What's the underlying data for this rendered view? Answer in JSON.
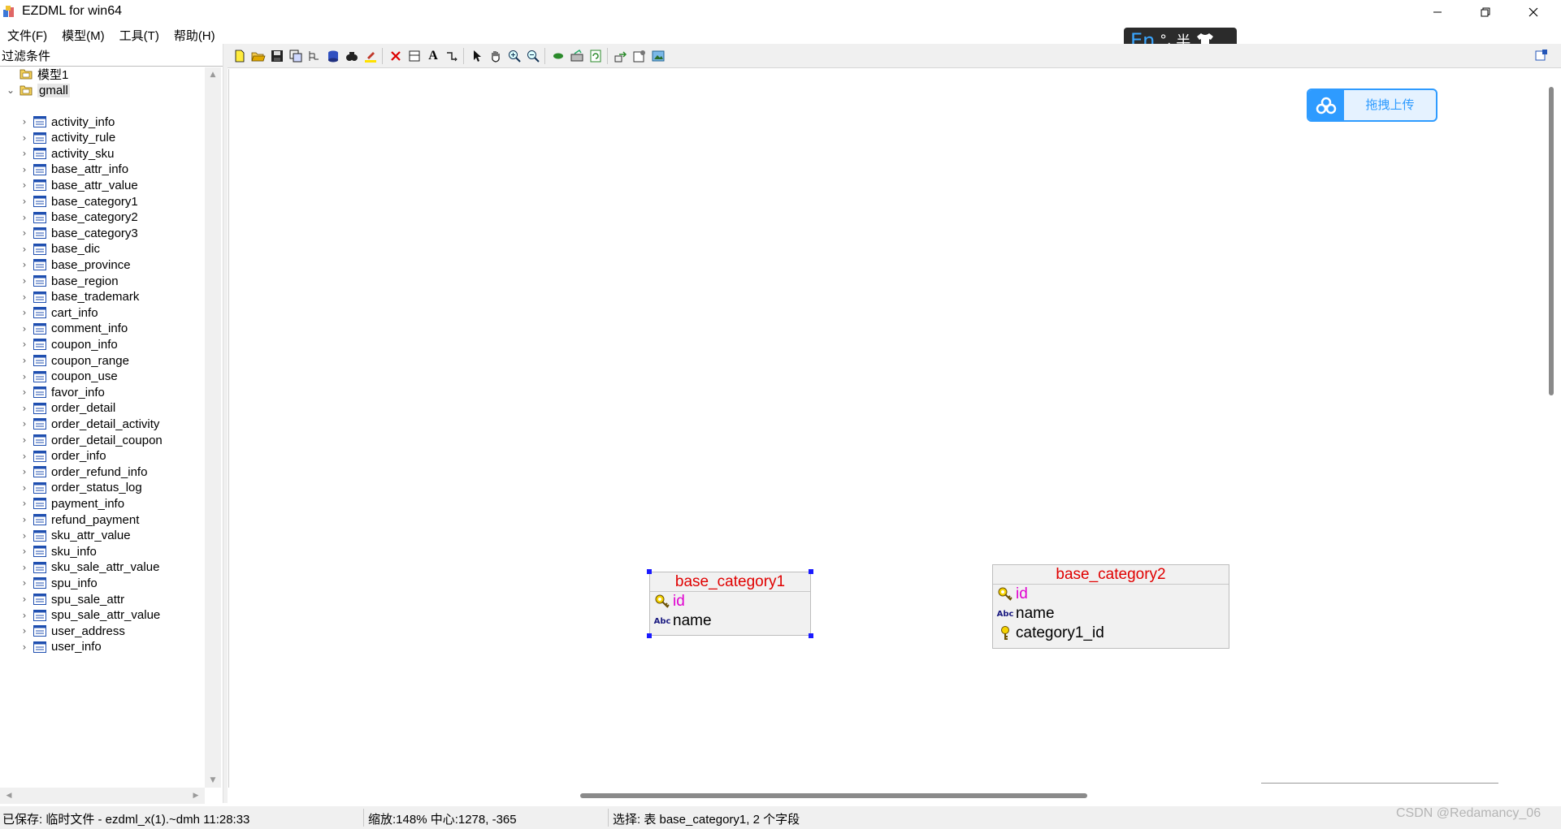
{
  "window": {
    "title": "EZDML for win64",
    "controls": {
      "minimize": "minimize-icon",
      "restore": "restore-icon",
      "close": "close-icon"
    }
  },
  "menu": [
    "文件(F)",
    "模型(M)",
    "工具(T)",
    "帮助(H)"
  ],
  "ime": {
    "lang": "En",
    "punct": "°,",
    "width": "半",
    "skin_icon": "shirt-icon"
  },
  "filter_label": "过滤条件",
  "tree": {
    "models": [
      {
        "label": "模型1",
        "icon": "model-folder-icon",
        "expanded": false
      },
      {
        "label": "gmall",
        "icon": "model-folder-icon",
        "expanded": true,
        "selected": true
      }
    ],
    "tables": [
      "activity_info",
      "activity_rule",
      "activity_sku",
      "base_attr_info",
      "base_attr_value",
      "base_category1",
      "base_category2",
      "base_category3",
      "base_dic",
      "base_province",
      "base_region",
      "base_trademark",
      "cart_info",
      "comment_info",
      "coupon_info",
      "coupon_range",
      "coupon_use",
      "favor_info",
      "order_detail",
      "order_detail_activity",
      "order_detail_coupon",
      "order_info",
      "order_refund_info",
      "order_status_log",
      "payment_info",
      "refund_payment",
      "sku_attr_value",
      "sku_info",
      "sku_sale_attr_value",
      "spu_info",
      "spu_sale_attr",
      "spu_sale_attr_value",
      "user_address",
      "user_info"
    ]
  },
  "toolbar": [
    "new-file-icon",
    "open-folder-icon",
    "save-icon",
    "save-as-icon",
    "tree-view-icon",
    "database-icon",
    "find-icon",
    "highlight-icon",
    "delete-icon",
    "table-icon",
    "text-icon",
    "link-icon",
    "pointer-icon",
    "hand-icon",
    "zoom-in-icon",
    "zoom-out-icon",
    "leaf-icon",
    "export-image-icon",
    "refresh-icon",
    "import-icon",
    "properties-icon",
    "image-icon"
  ],
  "toolbar_right_icon": "panel-toggle-icon",
  "upload_button": {
    "label": "拖拽上传",
    "icon": "cloud-icon"
  },
  "erd_tables": [
    {
      "name": "base_category1",
      "selected": true,
      "fields": [
        {
          "name": "id",
          "kind": "primary-key"
        },
        {
          "name": "name",
          "kind": "text"
        }
      ]
    },
    {
      "name": "base_category2",
      "selected": false,
      "fields": [
        {
          "name": "id",
          "kind": "primary-key"
        },
        {
          "name": "name",
          "kind": "text"
        },
        {
          "name": "category1_id",
          "kind": "foreign-key"
        }
      ]
    }
  ],
  "status": {
    "saved": "已保存: 临时文件 - ezdml_x(1).~dmh 11:28:33",
    "zoom": "缩放:148% 中心:1278, -365",
    "selection": "选择: 表 base_category1, 2 个字段"
  },
  "watermark": "CSDN @Redamancy_06",
  "colors": {
    "table_title": "#e00000",
    "pk_field": "#e000d0",
    "accent": "#2e9bff",
    "selection_handle": "#1a1aff"
  }
}
